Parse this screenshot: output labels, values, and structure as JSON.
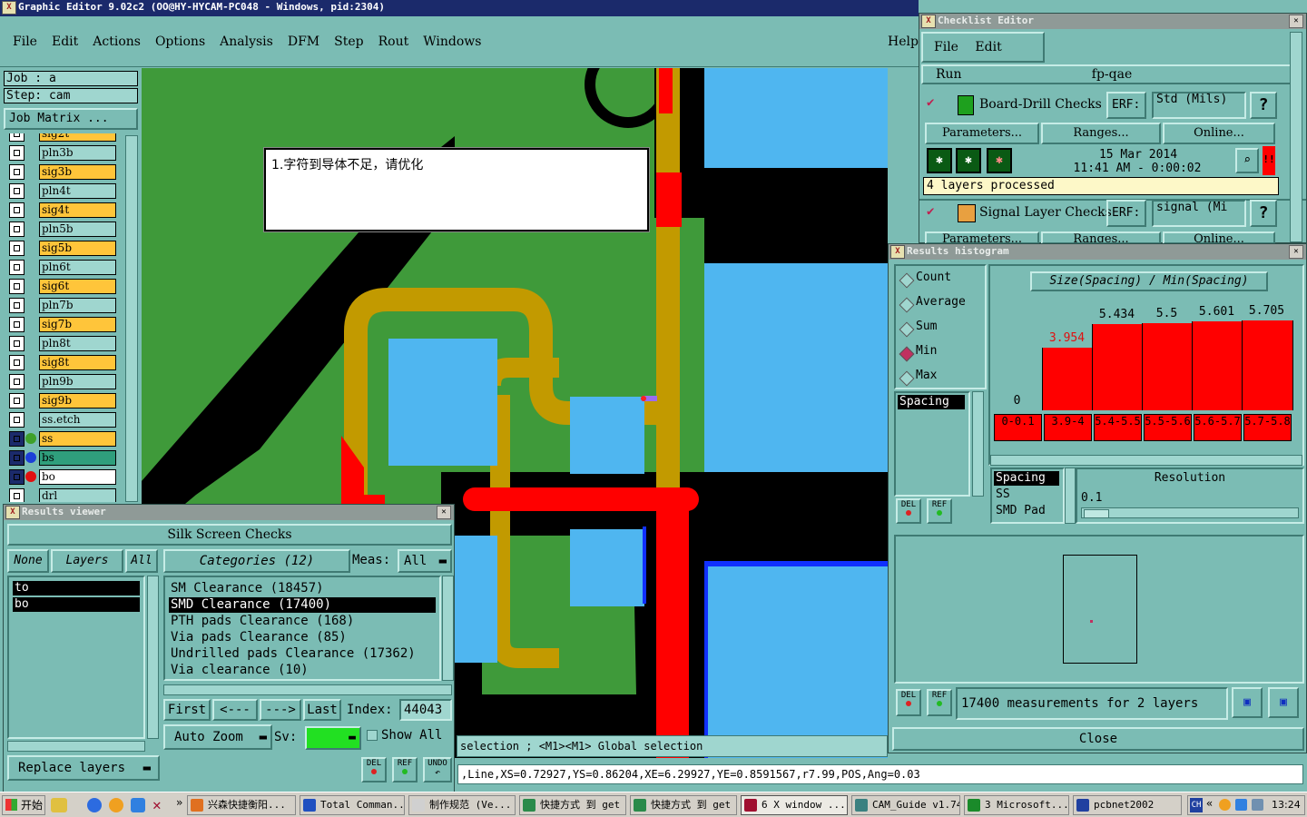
{
  "main_window": {
    "title": "Graphic Editor 9.02c2 (OO@HY-HYCAM-PC048 - Windows, pid:2304)",
    "menu": [
      "File",
      "Edit",
      "Actions",
      "Options",
      "Analysis",
      "DFM",
      "Step",
      "Rout",
      "Windows"
    ],
    "help": "Help",
    "job": "Job : a",
    "step": "Step: cam",
    "job_matrix": "Job Matrix ..."
  },
  "layers": [
    "sig2t",
    "pln3b",
    "sig3b",
    "pln4t",
    "sig4t",
    "pln5b",
    "sig5b",
    "pln6t",
    "sig6t",
    "pln7b",
    "sig7b",
    "pln8t",
    "sig8t",
    "pln9b",
    "sig9b",
    "ss.etch",
    "ss",
    "bs",
    "bo",
    "drl"
  ],
  "annotation_text": "1.字符到导体不足，请优化",
  "results_viewer": {
    "title": "Results viewer",
    "group": "Silk Screen Checks",
    "none": "None",
    "layers": "Layers",
    "all": "All",
    "layer_items": [
      "to",
      "bo"
    ],
    "categories": "Categories (12)",
    "meas_label": "Meas:",
    "meas_value": "All",
    "category_items": [
      "SM Clearance (18457)",
      "SMD Clearance (17400)",
      "PTH pads Clearance (168)",
      "Via pads Clearance (85)",
      "Undrilled pads Clearance (17362)",
      "Via clearance (10)"
    ],
    "first": "First",
    "prev": "<---",
    "next": "--->",
    "last": "Last",
    "index_label": "Index:",
    "index_value": "44043",
    "auto_zoom": "Auto Zoom",
    "sv_label": "Sv:",
    "show_all": "Show All",
    "replace_layers": "Replace layers",
    "del": "DEL",
    "ref": "REF",
    "undo": "UNDO"
  },
  "status": {
    "line1": "selection ; <M1><M1> Global selection",
    "line2": ",Line,XS=0.72927,YS=0.86204,XE=6.29927,YE=0.8591567,r7.99,POS,Ang=0.03"
  },
  "checklist": {
    "title": "Checklist Editor",
    "menu": [
      "File",
      "Edit",
      "Run"
    ],
    "name": "fp-qae",
    "check1": {
      "name": "Board-Drill Checks",
      "erf": "ERF:",
      "erf_value": "Std (Mils)",
      "params": "Parameters...",
      "ranges": "Ranges...",
      "online": "Online...",
      "date": "15 Mar 2014",
      "time": "11:41 AM - 0:00:02",
      "status": "4 layers processed"
    },
    "check2": {
      "name": "Signal Layer Checks",
      "erf": "ERF:",
      "erf_value": "signal (Mi",
      "params": "Parameters...",
      "ranges": "Ranges...",
      "online": "Online..."
    },
    "help_q": "?"
  },
  "histogram": {
    "title": "Results histogram",
    "options": [
      "Count",
      "Average",
      "Sum",
      "Min",
      "Max"
    ],
    "selected": "Min",
    "chart_title": "Size(Spacing) / Min(Spacing)",
    "list_header": "Spacing",
    "lower_list": [
      "Spacing",
      "SS",
      "SMD Pad"
    ],
    "resolution_label": "Resolution",
    "resolution_value": "0.1",
    "measurements": "17400 measurements for 2 layers",
    "close": "Close",
    "del": "DEL",
    "ref": "REF"
  },
  "chart_data": {
    "type": "bar",
    "categories": [
      "0-0.1",
      "3.9-4",
      "5.4-5.5",
      "5.5-5.6",
      "5.6-5.7",
      "5.7-5.8"
    ],
    "values": [
      0,
      3.954,
      5.434,
      5.5,
      5.601,
      5.705
    ],
    "value_labels": [
      "0",
      "3.954",
      "5.434",
      "5.5",
      "5.601",
      "5.705"
    ],
    "highlight_label_color": "#e01010",
    "bar_color": "#ff0000",
    "title": "Size(Spacing) / Min(Spacing)"
  },
  "taskbar": {
    "start": "开始",
    "tasks": [
      "兴森快捷衡阳...",
      "Total Comman...",
      "制作规范 (Ve...",
      "快捷方式 到 get",
      "快捷方式 到 get",
      "6 X window ...",
      "CAM_Guide v1.74",
      "3 Microsoft...",
      "pcbnet2002"
    ],
    "clock": "13:24",
    "lang": "CH"
  },
  "colors": {
    "panel": "#7bbcb4",
    "titlebar": "#1b2a6b",
    "board_green": "#3f9a3a",
    "trace_gold": "#c29a00",
    "pad_blue": "#4fb6f0",
    "red": "#ff0000",
    "orange": "#ffc53a"
  }
}
